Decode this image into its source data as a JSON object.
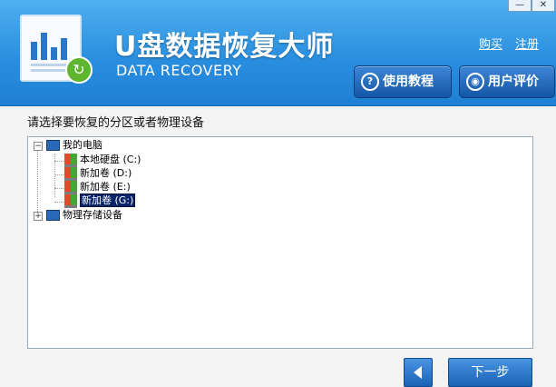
{
  "window": {
    "minimize_label": "—",
    "close_label": "✕"
  },
  "header": {
    "title": "U盘数据恢复大师",
    "subtitle": "DATA RECOVERY",
    "links": {
      "buy": "购买",
      "register": "注册"
    },
    "buttons": {
      "tutorial": {
        "label": "使用教程",
        "icon": "question-circle-icon"
      },
      "review": {
        "label": "用户评价",
        "icon": "chat-bubble-icon"
      }
    }
  },
  "main": {
    "prompt": "请选择要恢复的分区或者物理设备",
    "tree": {
      "my_computer": {
        "label": "我的电脑",
        "expander": "−"
      },
      "drives": [
        {
          "label": "本地硬盘 (C:)"
        },
        {
          "label": "新加卷 (D:)"
        },
        {
          "label": "新加卷 (E:)"
        },
        {
          "label": "新加卷 (G:)",
          "selected": true
        }
      ],
      "physical": {
        "label": "物理存储设备",
        "expander": "+"
      }
    }
  },
  "footer": {
    "back_icon": "left-arrow-icon",
    "next_label": "下一步"
  },
  "colors": {
    "header_blue": "#2a8fe0",
    "button_blue": "#1a62b5",
    "selection": "#0a246a"
  }
}
